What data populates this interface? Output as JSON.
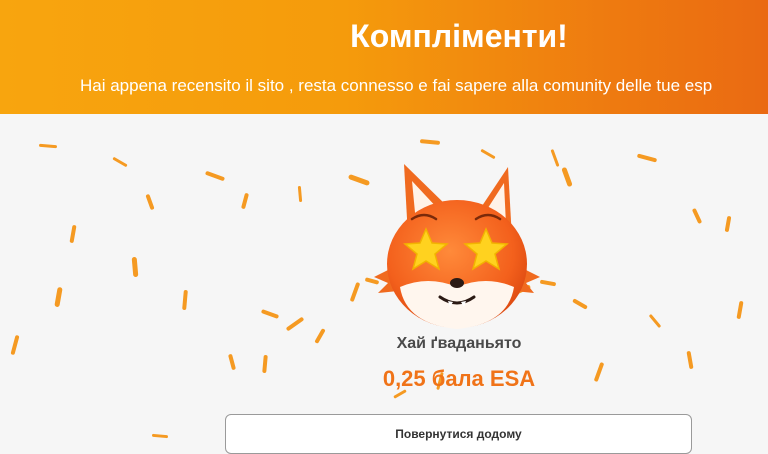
{
  "banner": {
    "title": "Компліменти!",
    "subtitle": "Hai appena recensito il sito , resta connesso e fai sapere alla comunity delle tue esp"
  },
  "reward": {
    "user_name": "Хай ґваданьято",
    "points": "0,25 бала ESA"
  },
  "actions": {
    "home_button": "Повернутися додому"
  },
  "colors": {
    "brand_orange": "#f07318",
    "banner_start": "#f8a50e",
    "banner_end": "#ea6a12"
  },
  "mascot_icon": "fox-star-eyes-icon"
}
